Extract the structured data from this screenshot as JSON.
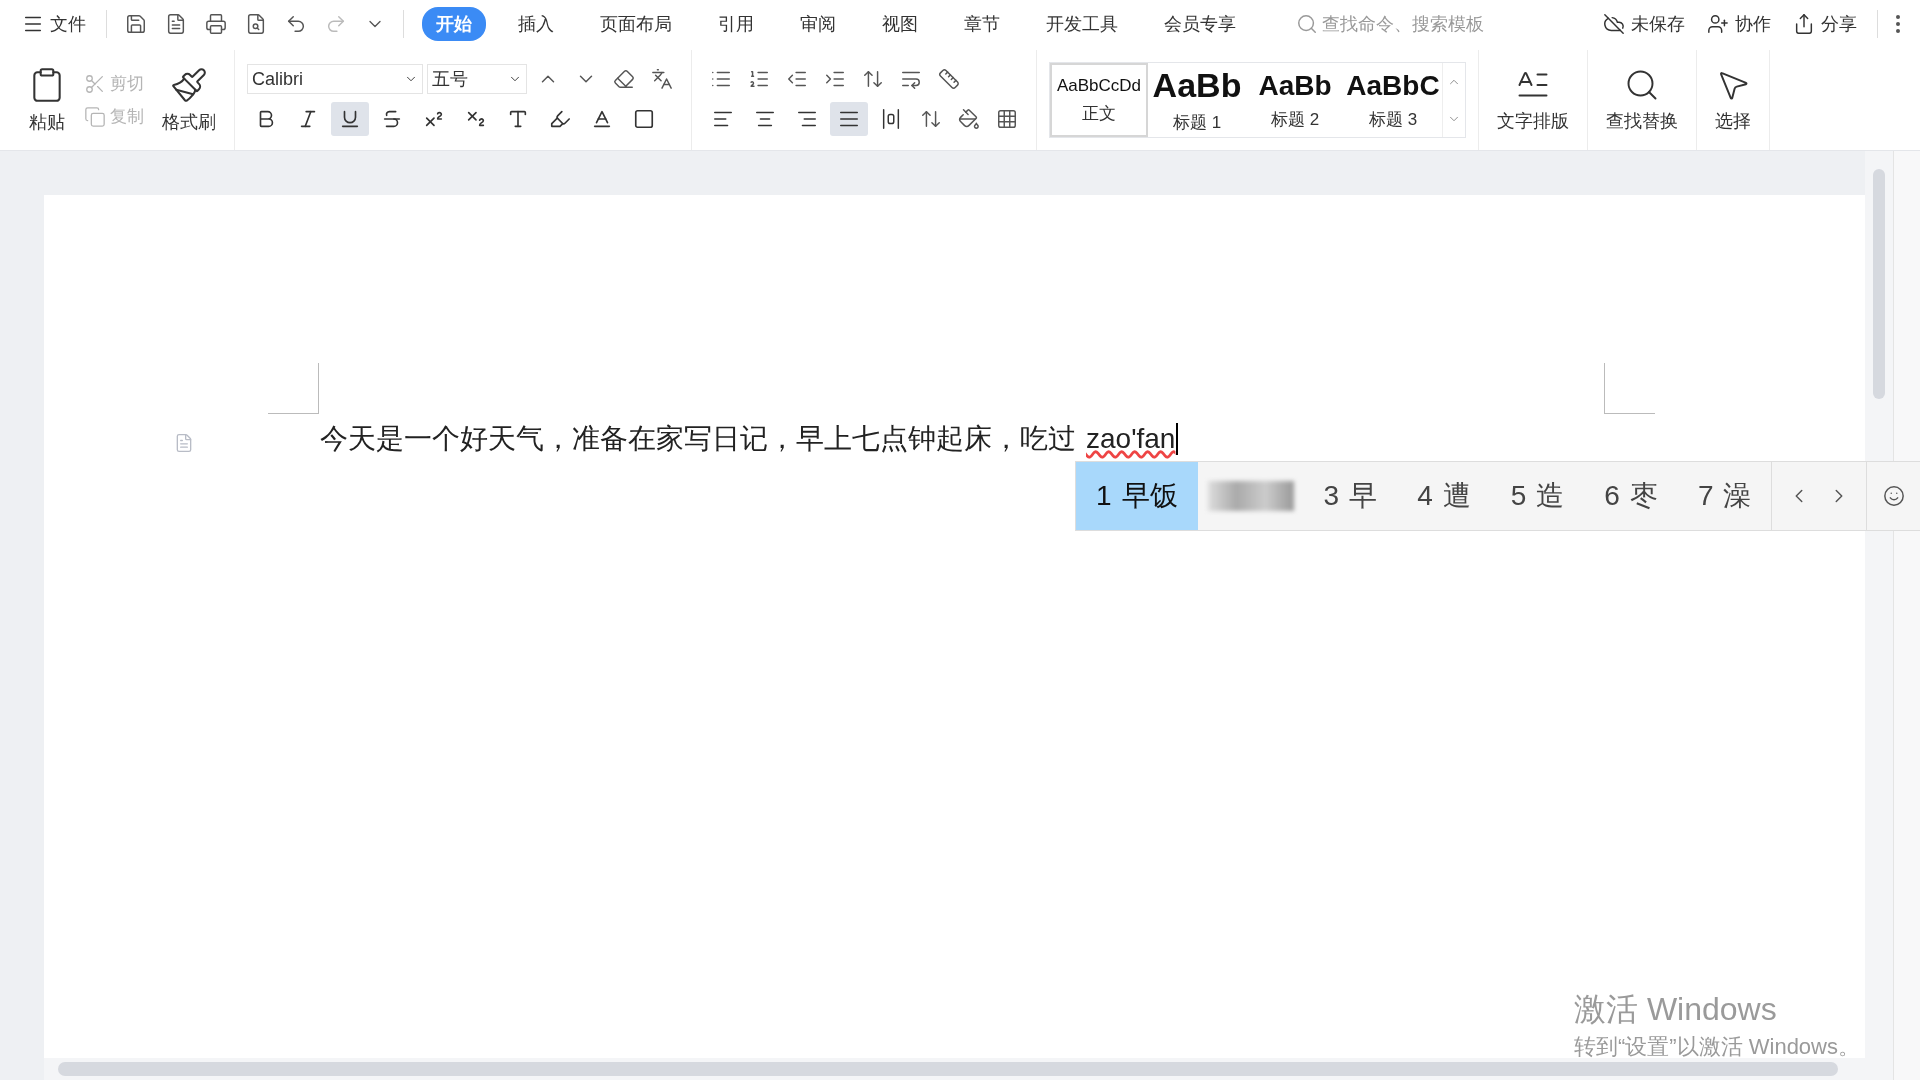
{
  "menu_bar": {
    "file_menu": "文件",
    "tabs": [
      {
        "label": "开始",
        "selected": true
      },
      {
        "label": "插入",
        "selected": false
      },
      {
        "label": "页面布局",
        "selected": false
      },
      {
        "label": "引用",
        "selected": false
      },
      {
        "label": "审阅",
        "selected": false
      },
      {
        "label": "视图",
        "selected": false
      },
      {
        "label": "章节",
        "selected": false
      },
      {
        "label": "开发工具",
        "selected": false
      },
      {
        "label": "会员专享",
        "selected": false
      }
    ],
    "search": {
      "placeholder": "查找命令、搜索模板"
    },
    "actions": [
      {
        "kind": "cloud",
        "label": "未保存"
      },
      {
        "kind": "collab",
        "label": "协作"
      },
      {
        "kind": "share",
        "label": "分享"
      }
    ]
  },
  "ribbon": {
    "clipboard": {
      "paste": "粘贴",
      "cut": {
        "label": "剪切",
        "disabled": true
      },
      "copy": {
        "label": "复制",
        "disabled": true
      },
      "format_painter": "格式刷"
    },
    "font": {
      "name": "Calibri",
      "size": "五号"
    },
    "format_buttons": [
      {
        "kind": "bold",
        "selected": false
      },
      {
        "kind": "italic",
        "selected": false
      },
      {
        "kind": "underline",
        "selected": true
      },
      {
        "kind": "strike",
        "selected": false
      },
      {
        "kind": "superscript",
        "selected": false
      },
      {
        "kind": "subscript",
        "selected": false
      },
      {
        "kind": "effect",
        "selected": false
      },
      {
        "kind": "highlight",
        "selected": false
      },
      {
        "kind": "color",
        "selected": false
      },
      {
        "kind": "border",
        "selected": false
      }
    ],
    "align_buttons": [
      {
        "kind": "left",
        "selected": false
      },
      {
        "kind": "center",
        "selected": false
      },
      {
        "kind": "right",
        "selected": false
      },
      {
        "kind": "justify",
        "selected": true
      },
      {
        "kind": "distribute",
        "selected": false
      }
    ],
    "styles": [
      {
        "preview": "AaBbCcDd",
        "label": "正文",
        "selected": true
      },
      {
        "preview": "AaBb",
        "label": "标题 1",
        "selected": false
      },
      {
        "preview": "AaBb",
        "label": "标题 2",
        "selected": false
      },
      {
        "preview": "AaBbC",
        "label": "标题 3",
        "selected": false
      }
    ],
    "tools": [
      {
        "kind": "layout",
        "label": "文字排版"
      },
      {
        "kind": "find",
        "label": "查找替换"
      },
      {
        "kind": "select",
        "label": "选择"
      }
    ]
  },
  "document": {
    "text": "今天是一个好天气，准备在家写日记，早上七点钟起床，吃过",
    "composition": "zao'fan"
  },
  "ime": {
    "candidates": [
      {
        "kind": "word",
        "index": "1",
        "text": "早饭",
        "selected": true
      },
      {
        "kind": "blurred",
        "selected": false
      },
      {
        "kind": "word",
        "index": "3",
        "text": "早",
        "selected": false
      },
      {
        "kind": "word",
        "index": "4",
        "text": "遭",
        "selected": false
      },
      {
        "kind": "word",
        "index": "5",
        "text": "造",
        "selected": false
      },
      {
        "kind": "word",
        "index": "6",
        "text": "枣",
        "selected": false
      },
      {
        "kind": "word",
        "index": "7",
        "text": "澡",
        "selected": false
      }
    ]
  },
  "activation_notice": {
    "title": "激活 Windows",
    "subtitle": "转到“设置”以激活 Windows。"
  }
}
